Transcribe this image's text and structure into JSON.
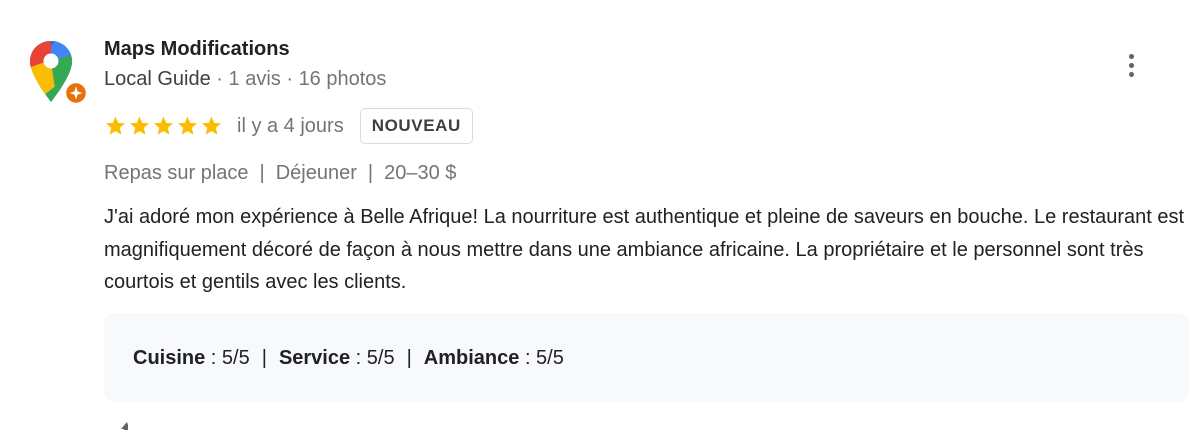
{
  "author": {
    "name": "Maps Modifications",
    "guide_label": "Local Guide",
    "reviews_count": "1 avis",
    "photos_count": "16 photos",
    "separator": " · "
  },
  "rating": {
    "stars": 5,
    "max_stars": 5,
    "time_ago": "il y a 4 jours",
    "badge": "NOUVEAU",
    "star_color": "#fbbc04"
  },
  "attributes": {
    "items": [
      "Repas sur place",
      "Déjeuner",
      "20–30 $"
    ],
    "separator": "|"
  },
  "review_text": "J'ai adoré mon expérience à Belle Afrique! La nourriture est authentique et pleine de saveurs en bouche. Le restaurant est magnifiquement décoré de façon à nous mettre dans une ambiance africaine. La propriétaire et le personnel sont très courtois et gentils avec les clients.",
  "subratings": [
    {
      "label": "Cuisine",
      "value": " : 5/5"
    },
    {
      "label": "Service",
      "value": " : 5/5"
    },
    {
      "label": "Ambiance",
      "value": " : 5/5"
    }
  ],
  "subratings_separator": "|",
  "icons": {
    "avatar": "google-maps-pin-icon",
    "local_guide": "local-guide-badge-icon",
    "more": "more-vert-icon",
    "star": "star-icon"
  }
}
